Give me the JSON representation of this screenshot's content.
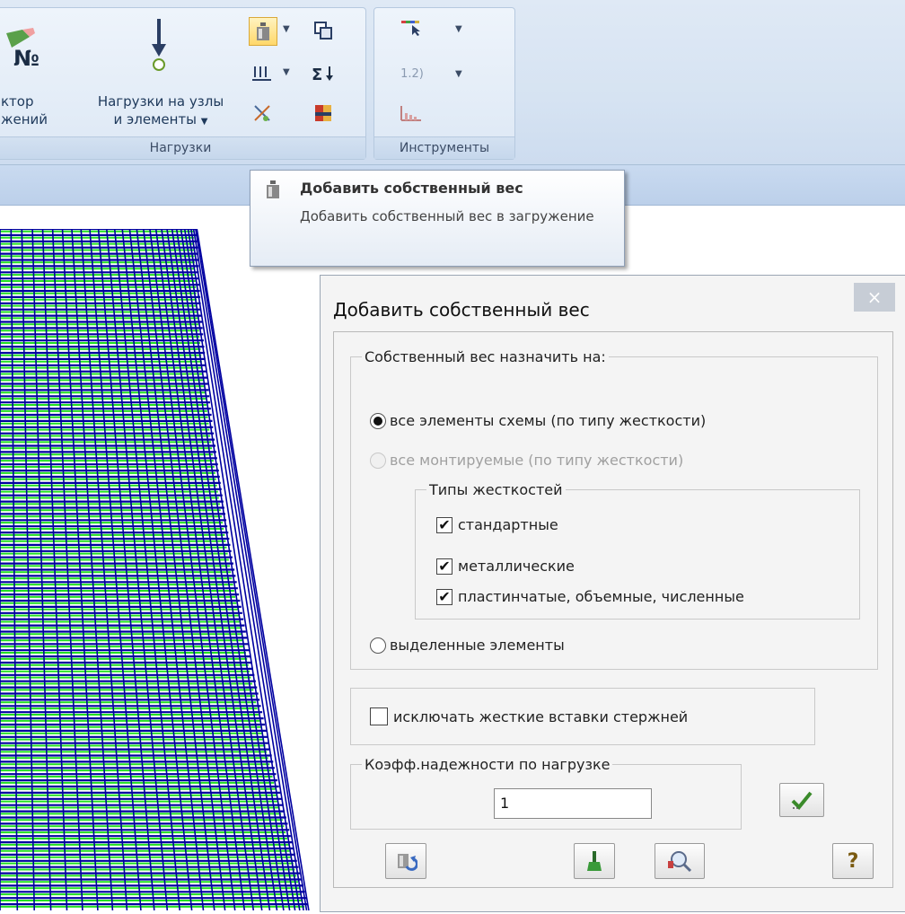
{
  "ribbon": {
    "editor_label_line1": "ктор",
    "editor_label_line2": "жений",
    "loads_button_line1": "Нагрузки на узлы",
    "loads_button_line2": "и элементы",
    "group_loads": "Нагрузки",
    "group_tools": "Инструменты",
    "tools_numbering": "1.2)"
  },
  "tooltip": {
    "title": "Добавить собственный вес",
    "description": "Добавить собственный вес в загружение"
  },
  "dialog": {
    "title": "Добавить собственный вес",
    "close": "×",
    "assign_group": "Собственный вес назначить на:",
    "opt_all": "все элементы схемы (по типу жесткости)",
    "opt_mounted": "все монтируемые (по типу жесткости)",
    "stiffness_group": "Типы жесткостей",
    "chk_standard": "стандартные",
    "chk_metal": "металлические",
    "chk_plate": "пластинчатые, объемные, численные",
    "opt_selected": "выделенные элементы",
    "exclude_rigid": "исключать жесткие вставки стержней",
    "coef_group": "Коэфф.надежности по нагрузке",
    "coef_value": "1",
    "help": "?"
  },
  "colors": {
    "mesh_blue": "#0000a0",
    "mesh_green": "#22e022",
    "accent": "#1e395b"
  }
}
